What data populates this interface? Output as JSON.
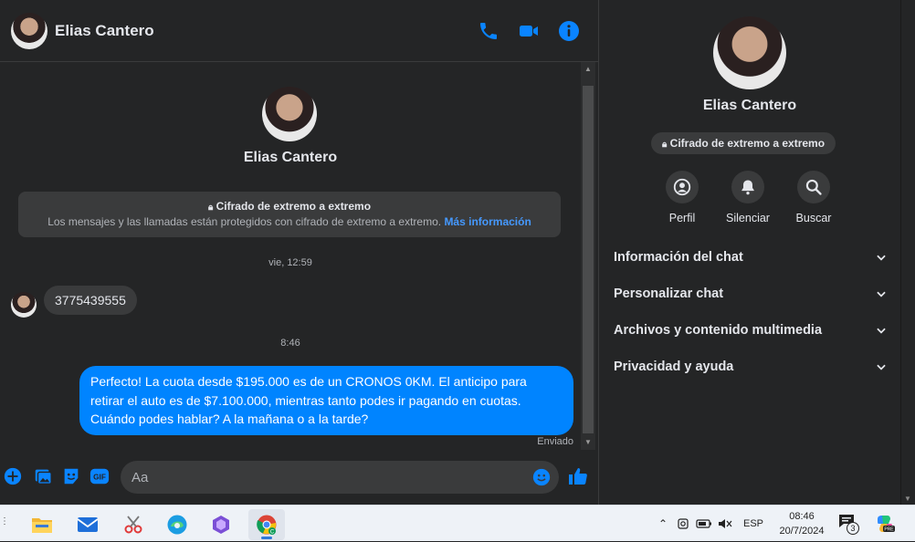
{
  "contact": {
    "name": "Elias Cantero"
  },
  "encryption": {
    "title": "Cifrado de extremo a extremo",
    "body": "Los mensajes y las llamadas están protegidos con cifrado de extremo a extremo.",
    "link": "Más información"
  },
  "messages": {
    "ts1": "vie, 12:59",
    "incoming": "3775439555",
    "ts2": "8:46",
    "outgoing": "Perfecto! La cuota desde $195.000 es de un CRONOS 0KM. El anticipo para retirar el auto es de $7.100.000, mientras tanto podes ir pagando en cuotas. Cuándo podes hablar? A la mañana o a la tarde?",
    "status": "Enviado"
  },
  "composer": {
    "placeholder": "Aa"
  },
  "side": {
    "actions": [
      "Perfil",
      "Silenciar",
      "Buscar"
    ],
    "sections": [
      "Información del chat",
      "Personalizar chat",
      "Archivos y contenido multimedia",
      "Privacidad y ayuda"
    ]
  },
  "taskbar": {
    "lang": "ESP",
    "time": "08:46",
    "date": "20/7/2024",
    "notif_count": "3"
  },
  "colors": {
    "accent": "#0084ff",
    "link": "#4599ff",
    "bg": "#242526",
    "bubble_in": "#3a3b3c"
  }
}
